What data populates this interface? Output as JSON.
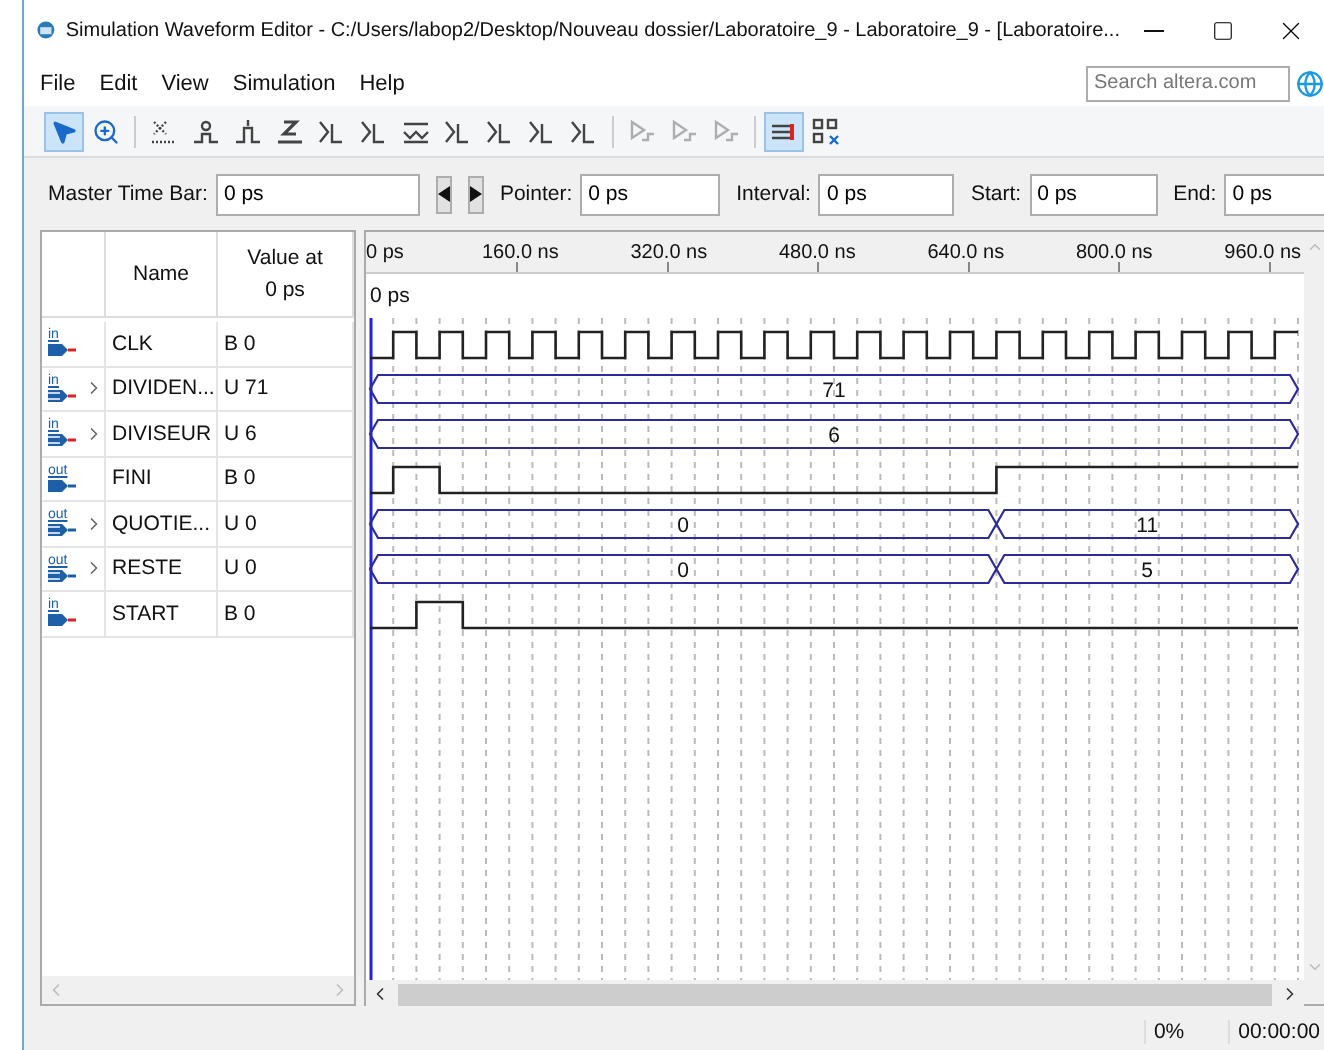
{
  "window": {
    "title": "Simulation Waveform Editor - C:/Users/labop2/Desktop/Nouveau dossier/Laboratoire_9 - Laboratoire_9 - [Laboratoire..."
  },
  "menu": [
    "File",
    "Edit",
    "View",
    "Simulation",
    "Help"
  ],
  "search": {
    "placeholder": "Search altera.com"
  },
  "toolbar": [
    [
      {
        "kind": "pointer",
        "selected": true,
        "disabled": false
      },
      {
        "kind": "zoom",
        "selected": false,
        "disabled": false
      }
    ],
    [
      {
        "kind": "unknown",
        "selected": false,
        "disabled": false
      },
      {
        "kind": "low",
        "selected": false,
        "disabled": false
      },
      {
        "kind": "high",
        "selected": false,
        "disabled": false
      },
      {
        "kind": "z",
        "selected": false,
        "disabled": false
      },
      {
        "kind": "bus",
        "selected": false,
        "disabled": false
      },
      {
        "kind": "bus",
        "selected": false,
        "disabled": false
      },
      {
        "kind": "invert",
        "selected": false,
        "disabled": false
      },
      {
        "kind": "bus",
        "selected": false,
        "disabled": false
      },
      {
        "kind": "bus",
        "selected": false,
        "disabled": false
      },
      {
        "kind": "bus",
        "selected": false,
        "disabled": false
      },
      {
        "kind": "bus",
        "selected": false,
        "disabled": false
      }
    ],
    [
      {
        "kind": "run",
        "selected": false,
        "disabled": true
      },
      {
        "kind": "run",
        "selected": false,
        "disabled": true
      },
      {
        "kind": "run",
        "selected": false,
        "disabled": true
      }
    ],
    [
      {
        "kind": "snap",
        "selected": true,
        "disabled": false
      },
      {
        "kind": "grid",
        "selected": false,
        "disabled": false
      }
    ]
  ],
  "time_bar": {
    "fields": [
      {
        "label": "Master Time Bar:",
        "value": "0 ps"
      },
      {
        "label": "Pointer:",
        "value": "0 ps"
      },
      {
        "label": "Interval:",
        "value": "0 ps"
      },
      {
        "label": "Start:",
        "value": "0 ps"
      },
      {
        "label": "End:",
        "value": "0 ps"
      }
    ]
  },
  "columns": {
    "name": "Name",
    "value": [
      "Value at",
      "0 ps"
    ]
  },
  "ruler": [
    "0 ps",
    "160.0 ns",
    "320.0 ns",
    "480.0 ns",
    "640.0 ns",
    "800.0 ns",
    "960.0 ns"
  ],
  "cursor_label": "0 ps",
  "signals": [
    {
      "port": "in",
      "kind": "bit",
      "expandable": false,
      "name": "CLK",
      "value": "B 0"
    },
    {
      "port": "in",
      "kind": "bus",
      "expandable": true,
      "name": "DIVIDEN...",
      "value": "U 71",
      "segments": [
        "71"
      ]
    },
    {
      "port": "in",
      "kind": "bus",
      "expandable": true,
      "name": "DIVISEUR",
      "value": "U 6",
      "segments": [
        "6"
      ]
    },
    {
      "port": "out",
      "kind": "bit",
      "expandable": false,
      "name": "FINI",
      "value": "B 0"
    },
    {
      "port": "out",
      "kind": "bus",
      "expandable": true,
      "name": "QUOTIE...",
      "value": "U 0",
      "segments": [
        "0",
        "11"
      ]
    },
    {
      "port": "out",
      "kind": "bus",
      "expandable": true,
      "name": "RESTE",
      "value": "U 0",
      "segments": [
        "0",
        "5"
      ]
    },
    {
      "port": "in",
      "kind": "bit",
      "expandable": false,
      "name": "START",
      "value": "B 0"
    }
  ],
  "status_bar": [
    "0%",
    "00:00:00"
  ]
}
